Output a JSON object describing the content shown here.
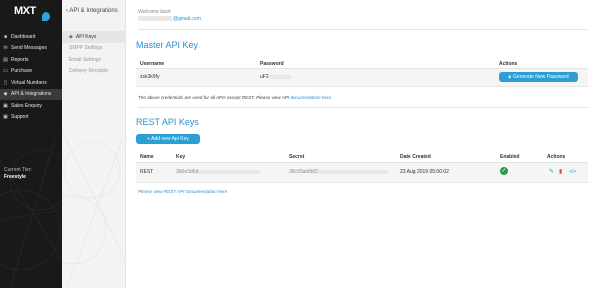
{
  "sidebar": {
    "logo_text": "MXT",
    "items": [
      {
        "label": "Dashboard",
        "icon": "dashboard-icon",
        "glyph": "■"
      },
      {
        "label": "Send Messages",
        "icon": "send-icon",
        "glyph": "✉"
      },
      {
        "label": "Reports",
        "icon": "chart-icon",
        "glyph": "▤"
      },
      {
        "label": "Purchase",
        "icon": "cart-icon",
        "glyph": "▭"
      },
      {
        "label": "Virtual Numbers",
        "icon": "phone-icon",
        "glyph": "▯"
      },
      {
        "label": "API & Integrations",
        "icon": "code-icon",
        "glyph": "◆"
      },
      {
        "label": "Sales Enquiry",
        "icon": "enquiry-icon",
        "glyph": "▣"
      },
      {
        "label": "Support",
        "icon": "support-icon",
        "glyph": "▣"
      }
    ],
    "active_index": 5,
    "tier_label": "Current Tier:",
    "tier_value": "Freestyle"
  },
  "submenu": {
    "title": "API & Integrations",
    "items": [
      {
        "label": "API Keys",
        "active": true
      },
      {
        "label": "SMPP Settings",
        "active": false
      },
      {
        "label": "Email Settings",
        "active": false
      },
      {
        "label": "Delivery Receipts",
        "active": false
      }
    ]
  },
  "header": {
    "welcome": "Welcome back",
    "email_domain": "@gmail.com"
  },
  "master": {
    "title": "Master API Key",
    "col_username": "Username",
    "col_password": "Password",
    "col_actions": "Actions",
    "username": "zsk3k9fy",
    "password_prefix": "uF2",
    "generate_button": "Generate New Password",
    "note_text": "The above credentials are used for all APIs except REST. Please view API ",
    "note_link": "documentation here."
  },
  "rest": {
    "title": "REST API Keys",
    "add_button": "+ Add new Api Key",
    "col_name": "Name",
    "col_key": "Key",
    "col_secret": "Secret",
    "col_date": "Date Created",
    "col_enabled": "Enabled",
    "col_actions": "Actions",
    "row": {
      "name": "REST",
      "key_prefix": "3b6e3d6d",
      "secret_prefix": "39c93ab8fd2",
      "date": "23 Aug 2019 05:00:02"
    },
    "doc_link": "Please view REST API Documentation here"
  },
  "colors": {
    "accent": "#2a9fd6",
    "sidebar_bg": "#191919",
    "enabled": "#2e9a48",
    "delete": "#d9534f"
  }
}
